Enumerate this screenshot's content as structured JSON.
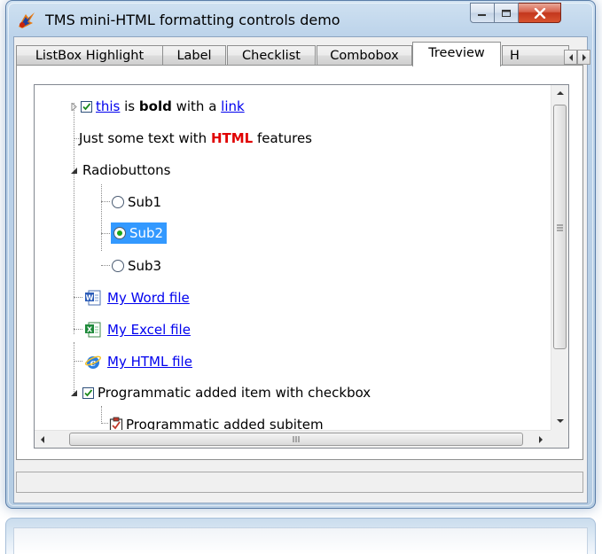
{
  "window": {
    "title": "TMS mini-HTML formatting controls demo",
    "icon": "tms-app-icon"
  },
  "tabs": [
    {
      "label": "ListBox Highlight",
      "active": false
    },
    {
      "label": "Label",
      "active": false
    },
    {
      "label": "Checklist",
      "active": false
    },
    {
      "label": "Combobox",
      "active": false
    },
    {
      "label": "Treeview",
      "active": true
    },
    {
      "label": "H",
      "active": false
    }
  ],
  "tree": {
    "node1": {
      "checked": true,
      "link1": "this",
      "text1": " is ",
      "bold": "bold",
      "text2": " with a ",
      "link2": "link"
    },
    "node2": {
      "text1": "Just some text with ",
      "highlight": "HTML",
      "text2": " features"
    },
    "node3": {
      "label": "Radiobuttons",
      "children": [
        "Sub1",
        "Sub2",
        "Sub3"
      ],
      "selected": "Sub2"
    },
    "word": {
      "label": "My Word file",
      "icon": "word-doc-icon"
    },
    "excel": {
      "label": "My Excel file",
      "icon": "excel-doc-icon"
    },
    "html": {
      "label": "My HTML file",
      "icon": "ie-html-icon"
    },
    "node7": {
      "checked": true,
      "label": "Programmatic added item with checkbox"
    },
    "node8": {
      "label": "Programmatic added subitem",
      "icon": "clipboard-check-icon"
    }
  },
  "colors": {
    "link": "#0000ee",
    "html_highlight": "#e00000",
    "selection": "#3399ff",
    "window_frame": "#bcd3ea"
  }
}
